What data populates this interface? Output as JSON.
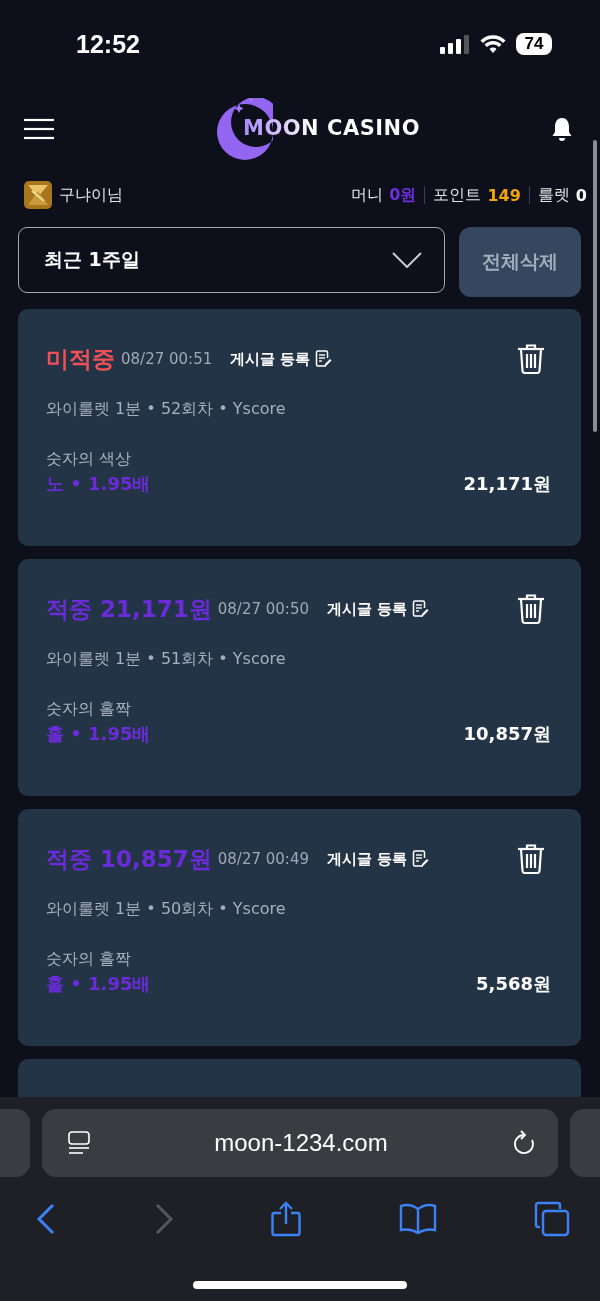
{
  "status_bar": {
    "time": "12:52",
    "battery": "74"
  },
  "header": {
    "logo_text": "MOON CASINO"
  },
  "user": {
    "name": "구냐이님",
    "balances": [
      {
        "label": "머니",
        "value": "0원",
        "kind": "money"
      },
      {
        "label": "포인트",
        "value": "149",
        "kind": "point"
      },
      {
        "label": "룰렛",
        "value": "0",
        "kind": "roulette"
      }
    ]
  },
  "filter": {
    "period": "최근 1주일",
    "delete_all": "전체삭제"
  },
  "bets": [
    {
      "kind": "miss",
      "title": "미적중",
      "time": "08/27 00:51",
      "post_label": "게시글 등록",
      "meta": "와이룰렛 1분 • 52회차 • Yscore",
      "bet_type": "숫자의 색상",
      "pick": "노 • 1.95배",
      "amount": "21,171원"
    },
    {
      "kind": "win",
      "title": "적중 21,171원",
      "time": "08/27 00:50",
      "post_label": "게시글 등록",
      "meta": "와이룰렛 1분 • 51회차 • Yscore",
      "bet_type": "숫자의 홀짝",
      "pick": "홀 • 1.95배",
      "amount": "10,857원"
    },
    {
      "kind": "win",
      "title": "적중 10,857원",
      "time": "08/27 00:49",
      "post_label": "게시글 등록",
      "meta": "와이룰렛 1분 • 50회차 • Yscore",
      "bet_type": "숫자의 홀짝",
      "pick": "홀 • 1.95배",
      "amount": "5,568원"
    }
  ],
  "more_below": true,
  "browser": {
    "url": "moon-1234.com",
    "back_disabled": false,
    "forward_disabled": true
  }
}
